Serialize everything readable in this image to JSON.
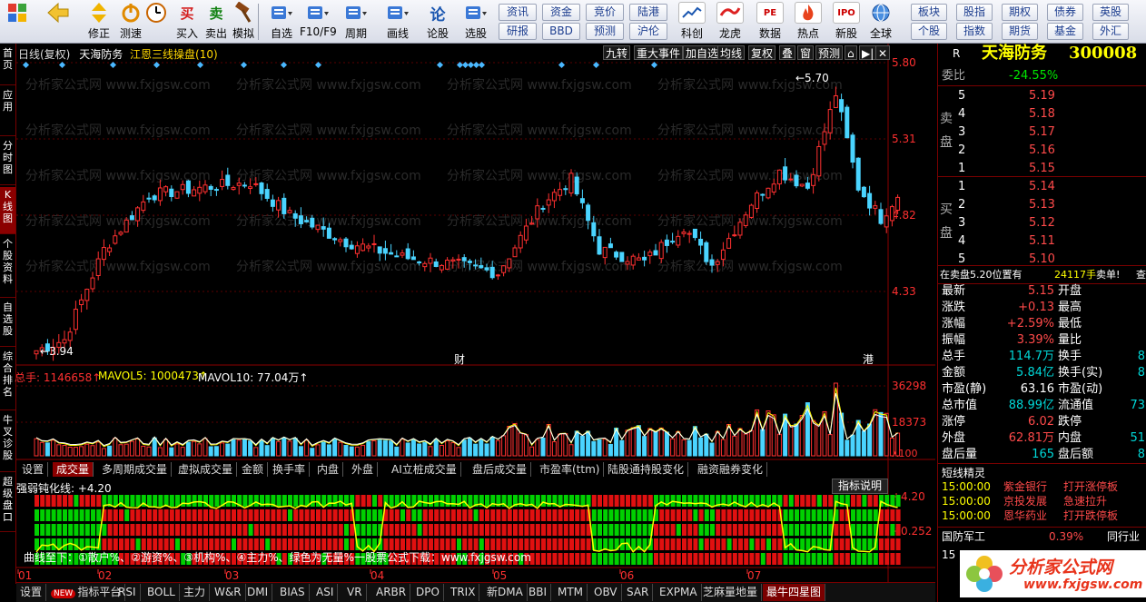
{
  "toolbar": {
    "buttons": [
      {
        "label": "",
        "icon": "windows-logo-icon"
      },
      {
        "label": "",
        "icon": "back-arrow-icon"
      },
      {
        "label": "修正",
        "icon": "up-down-arrows-icon"
      },
      {
        "label": "测速",
        "icon": "power-icon"
      },
      {
        "label": "",
        "icon": "clock-icon"
      },
      {
        "label": "买入",
        "glyph": "买"
      },
      {
        "label": "卖出",
        "glyph": "卖"
      },
      {
        "label": "模拟",
        "icon": "hammer-icon"
      },
      {
        "label": "自选",
        "icon": "folder-icon"
      },
      {
        "label": "F10/F9",
        "icon": "doc-icon"
      },
      {
        "label": "周期",
        "icon": "cycle-icon"
      },
      {
        "label": "画线",
        "icon": "pencil-icon"
      },
      {
        "label": "论股",
        "glyph": "论"
      },
      {
        "label": "选股",
        "icon": "magnifier-chart-icon"
      }
    ],
    "small_buttons": [
      [
        "资讯",
        "资金",
        "竞价",
        "陆港"
      ],
      [
        "研报",
        "BBD",
        "预测",
        "沪伦"
      ]
    ],
    "feature_buttons": [
      {
        "label": "科创",
        "icon": "chart-icon"
      },
      {
        "label": "龙虎",
        "icon": "dragon-icon"
      },
      {
        "label": "数据",
        "glyph": "PE"
      },
      {
        "label": "热点",
        "icon": "fire-icon"
      },
      {
        "label": "新股",
        "glyph": "IPO"
      },
      {
        "label": "全球",
        "icon": "globe-icon"
      }
    ],
    "right_buttons": [
      [
        "板块",
        "股指",
        "期权",
        "债券",
        "英股"
      ],
      [
        "个股",
        "指数",
        "期货",
        "基金",
        "外汇"
      ]
    ]
  },
  "leftnav": [
    {
      "label": "首页"
    },
    {
      "label": "应用"
    },
    {
      "label": "分时图"
    },
    {
      "label": "K线图"
    },
    {
      "label": "个股资料"
    },
    {
      "label": "自选股"
    },
    {
      "label": "综合排名"
    },
    {
      "label": "牛叉诊股"
    },
    {
      "label": "超级盘口"
    }
  ],
  "kchart": {
    "header": {
      "period": "日线(复权)",
      "stock": "天海防务",
      "indicator": "江恩三线操盘(10)"
    },
    "tools": [
      "九转",
      "重大事件",
      "加自选",
      "均线",
      "复权",
      "叠",
      "窗",
      "预测",
      "⌂",
      "▶|",
      "✕"
    ],
    "price_axis": [
      "5.80",
      "5.31",
      "4.82",
      "4.33"
    ],
    "high_label": "5.70",
    "low_label": "3.94",
    "markers": [
      "财",
      "港"
    ]
  },
  "volume": {
    "label": "总手: 1146658↑",
    "mavol5": "MAVOL5: 1000473↑",
    "mavol10": "MAVOL10: 77.04万↑",
    "axis": [
      "36298",
      "18373",
      "X100"
    ]
  },
  "tabs": [
    "设置",
    "成交量",
    "多周期成交量",
    "虚拟成交量",
    "金额",
    "换手率",
    "内盘",
    "外盘",
    "AI立桩成交量",
    "盘后成交量",
    "市盈率(ttm)",
    "陆股通持股变化",
    "融资融券变化"
  ],
  "indicator": {
    "label": "强弱钝化线: +4.20",
    "help": "指标说明",
    "axis": [
      "+4.20",
      "+0.252"
    ],
    "watermark": "曲线至下：①散户%、②游资%、③机构%、④主力%、绿色为无量%一股票公式下载：www.fxjgsw.com"
  },
  "months": [
    "01",
    "02",
    "03",
    "04",
    "05",
    "06",
    "07"
  ],
  "bottom_tabs": [
    "设置",
    "指标平台",
    "RSI",
    "BOLL",
    "主力",
    "W&R",
    "DMI",
    "BIAS",
    "ASI",
    "VR",
    "ARBR",
    "DPO",
    "TRIX",
    "新DMA",
    "BBI",
    "MTM",
    "OBV",
    "SAR",
    "EXPMA",
    "芝麻量地量",
    "最牛四星图"
  ],
  "new_badge": "NEW",
  "watermark_text": "分析家公式网 www.fxjgsw.com",
  "rightpanel": {
    "code_prefix": "R",
    "name": "天海防务",
    "code": "300008",
    "webi": {
      "label": "委比",
      "value": "-24.55%"
    },
    "sell_label": "卖盘",
    "buy_label": "买盘",
    "asks": [
      {
        "n": "5",
        "p": "5.19"
      },
      {
        "n": "4",
        "p": "5.18"
      },
      {
        "n": "3",
        "p": "5.17"
      },
      {
        "n": "2",
        "p": "5.16"
      },
      {
        "n": "1",
        "p": "5.15"
      }
    ],
    "bids": [
      {
        "n": "1",
        "p": "5.14"
      },
      {
        "n": "2",
        "p": "5.13"
      },
      {
        "n": "3",
        "p": "5.12"
      },
      {
        "n": "4",
        "p": "5.11"
      },
      {
        "n": "5",
        "p": "5.10"
      }
    ],
    "notice": {
      "a": "在卖盘5.20位置有",
      "b": "24117手",
      "c": "卖单!",
      "d": "查"
    },
    "stats": [
      {
        "k": "最新",
        "v": "5.15",
        "c": "red",
        "k2": "开盘"
      },
      {
        "k": "涨跌",
        "v": "+0.13",
        "c": "red",
        "k2": "最高"
      },
      {
        "k": "涨幅",
        "v": "+2.59%",
        "c": "red",
        "k2": "最低"
      },
      {
        "k": "振幅",
        "v": "3.39%",
        "c": "red",
        "k2": "量比"
      },
      {
        "k": "总手",
        "v": "114.7万",
        "c": "cyan",
        "k2": "换手"
      },
      {
        "k": "金额",
        "v": "5.84亿",
        "c": "cyan",
        "k2": "换手(实)"
      },
      {
        "k": "市盈(静)",
        "v": "63.16",
        "c": "white",
        "k2": "市盈(动)"
      },
      {
        "k": "总市值",
        "v": "88.99亿",
        "c": "cyan",
        "k2": "流通值"
      },
      {
        "k": "涨停",
        "v": "6.02",
        "c": "red",
        "k2": "跌停"
      },
      {
        "k": "外盘",
        "v": "62.81万",
        "c": "red",
        "k2": "内盘"
      },
      {
        "k": "盘后量",
        "v": "165",
        "c": "cyan",
        "k2": "盘后额"
      }
    ],
    "stats_right": [
      "",
      "",
      "",
      "",
      "8",
      "8",
      "",
      "73",
      "",
      "51",
      "8"
    ],
    "short_title": "短线精灵",
    "short_list": [
      {
        "t": "15:00:00",
        "n": "紫金银行",
        "a": "打开涨停板"
      },
      {
        "t": "15:00:00",
        "n": "京投发展",
        "a": "急速拉升"
      },
      {
        "t": "15:00:00",
        "n": "恩华药业",
        "a": "打开跌停板"
      }
    ],
    "bottom": {
      "name": "国防军工",
      "pct": "0.39%",
      "more": "同行业",
      "row2": "15"
    },
    "logo_main": "分析家公式网",
    "logo_url": "www.fxjgsw.com"
  }
}
